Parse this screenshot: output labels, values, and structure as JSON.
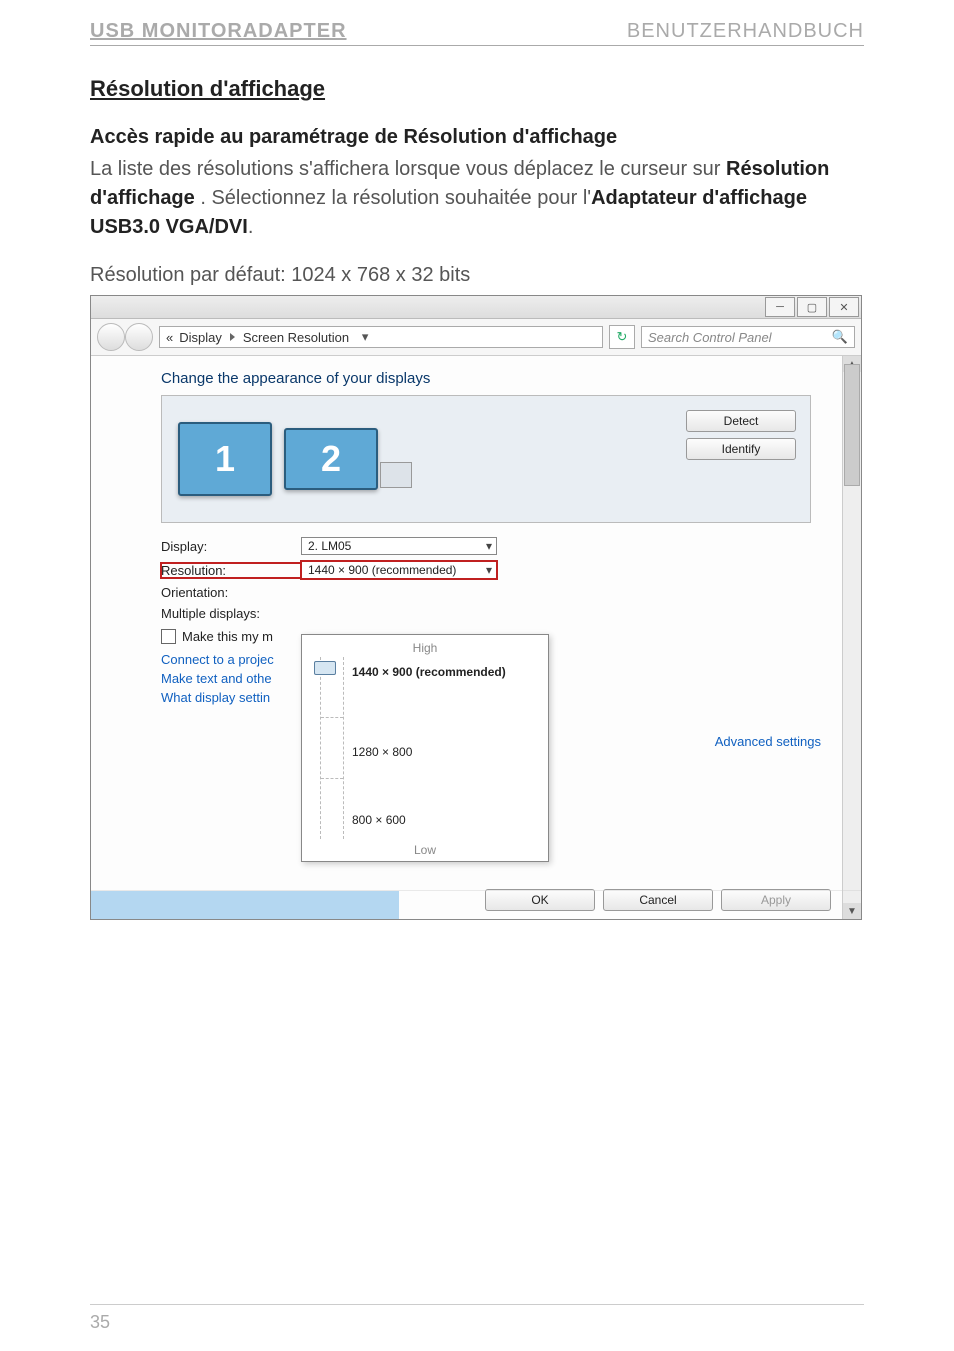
{
  "header": {
    "left": "USB MONITORADAPTER",
    "right": "BENUTZERHANDBUCH"
  },
  "section_title": "Résolution d'affichage",
  "subheading": "Accès rapide au paramétrage de Résolution d'affichage",
  "body": {
    "line1a": "La liste des résolutions s'affichera lorsque vous déplacez le curseur sur ",
    "line1b": "Résolution d'affichage",
    "line1c": ".   Sélectionnez la résolution souhaitée pour l'",
    "line1d": "Adaptateur d'affichage USB3.0 VGA/DVI",
    "line1e": "."
  },
  "default_res": "Résolution par défaut: 1024 x 768 x 32 bits",
  "win": {
    "minimize": "─",
    "maximize": "▢",
    "close": "✕"
  },
  "breadcrumb": {
    "back": "«",
    "seg1": "Display",
    "seg2": "Screen Resolution",
    "refresh": "↻"
  },
  "search": {
    "placeholder": "Search Control Panel",
    "mag": "🔍"
  },
  "panel_title": "Change the appearance of your displays",
  "monitors": {
    "m1": "1",
    "m2": "2"
  },
  "side_buttons": {
    "detect": "Detect",
    "identify": "Identify"
  },
  "form": {
    "display_label": "Display:",
    "display_value": "2. LM05",
    "resolution_label": "Resolution:",
    "resolution_value": "1440 × 900 (recommended)",
    "orientation_label": "Orientation:",
    "multiple_label": "Multiple displays:",
    "make_main": "Make this my m",
    "connect_proj": "Connect to a projec",
    "make_text": "Make text and othe",
    "what_settings": "What display settin"
  },
  "popup": {
    "high": "High",
    "rec": "1440 × 900 (recommended)",
    "mid": "1280 × 800",
    "small": "800 × 600",
    "low": "Low"
  },
  "advanced": "Advanced settings",
  "buttons": {
    "ok": "OK",
    "cancel": "Cancel",
    "apply": "Apply"
  },
  "scroll": {
    "up": "▲",
    "down": "▼"
  },
  "page_number": "35"
}
